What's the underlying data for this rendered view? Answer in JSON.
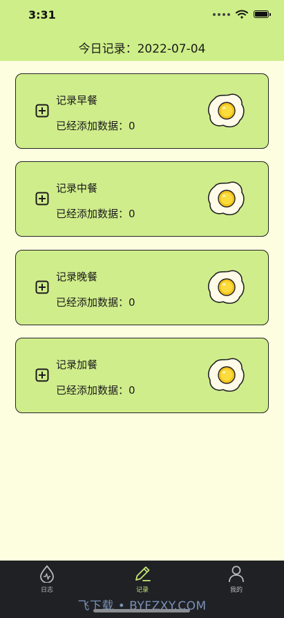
{
  "status_bar": {
    "time": "3:31"
  },
  "header": {
    "title": "今日记录：2022-07-04"
  },
  "cards": [
    {
      "title": "记录早餐",
      "count": "已经添加数据：0"
    },
    {
      "title": "记录中餐",
      "count": "已经添加数据：0"
    },
    {
      "title": "记录晚餐",
      "count": "已经添加数据：0"
    },
    {
      "title": "记录加餐",
      "count": "已经添加数据：0"
    }
  ],
  "icons": {
    "add": "plus-square-icon",
    "egg": "fried-egg-icon",
    "diary": "droplet-icon",
    "record": "pencil-icon",
    "mine": "person-icon"
  },
  "tabbar": {
    "items": [
      {
        "label": "日志",
        "active": false
      },
      {
        "label": "记录",
        "active": true
      },
      {
        "label": "我的",
        "active": false
      }
    ]
  },
  "watermark": "飞下载 • BYFZXY.COM",
  "colors": {
    "header": "#cdee88",
    "card": "#d0ed8c",
    "background": "#fdfde0",
    "tab_active": "#c8e87a",
    "tab_inactive": "#b9bbbe",
    "tabbar": "#1f2124"
  }
}
